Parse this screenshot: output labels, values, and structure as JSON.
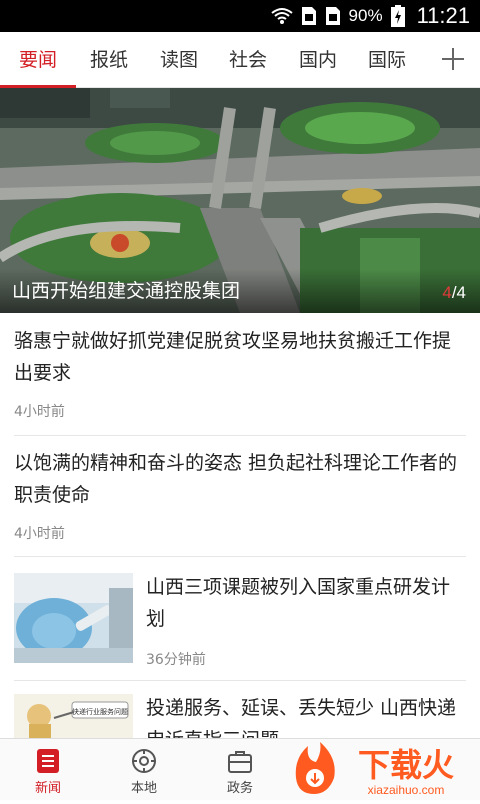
{
  "status": {
    "battery": "90%",
    "time": "11:21"
  },
  "tabs": [
    {
      "label": "要闻"
    },
    {
      "label": "报纸"
    },
    {
      "label": "读图"
    },
    {
      "label": "社会"
    },
    {
      "label": "国内"
    },
    {
      "label": "国际"
    }
  ],
  "banner": {
    "title": "山西开始组建交通控股集团",
    "current": "4",
    "total": "/4"
  },
  "news": [
    {
      "title": "骆惠宁就做好抓党建促脱贫攻坚易地扶贫搬迁工作提出要求",
      "time": "4小时前"
    },
    {
      "title": "以饱满的精神和奋斗的姿态 担负起社科理论工作者的职责使命",
      "time": "4小时前"
    },
    {
      "title": "山西三项课题被列入国家重点研发计划",
      "time": "36分钟前"
    },
    {
      "title": "投递服务、延误、丢失短少 山西快递申诉直指三问题",
      "time": ""
    }
  ],
  "thumb_caption": "快递行业服务问题",
  "bottom_nav": [
    {
      "label": "新闻"
    },
    {
      "label": "本地"
    },
    {
      "label": "政务"
    }
  ],
  "watermark": {
    "text": "下载火",
    "url": "xiazaihuo.com"
  },
  "colors": {
    "accent": "#d21e24",
    "watermark": "#ff5a1f"
  }
}
